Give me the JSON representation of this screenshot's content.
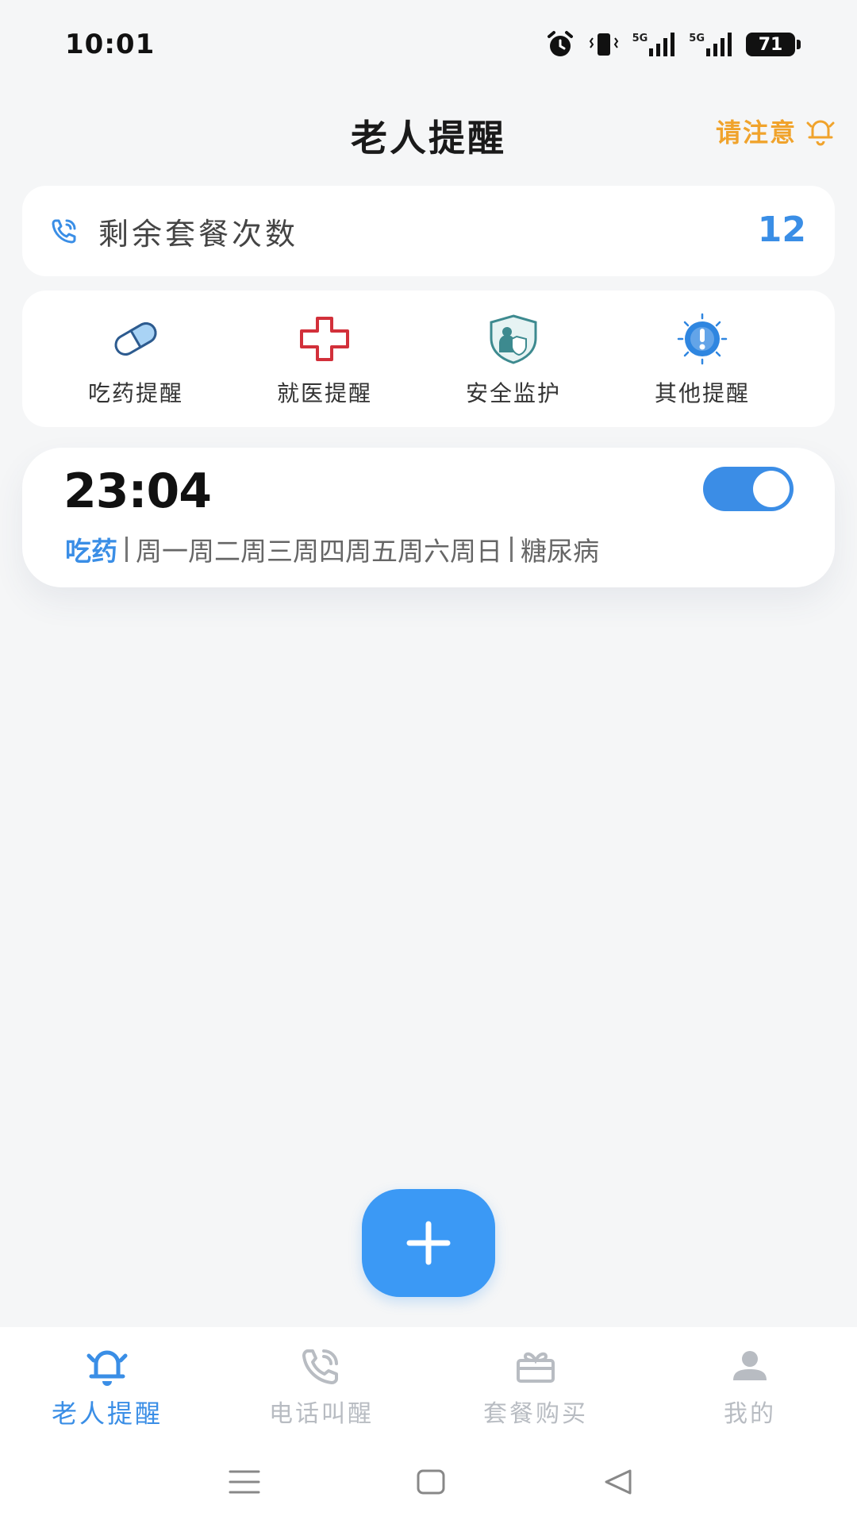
{
  "status_bar": {
    "time": "10:01",
    "signal_1_label": "5G",
    "signal_2_label": "5G",
    "battery": "71"
  },
  "header": {
    "title": "老人提醒",
    "attention_label": "请注意",
    "attention_color": "#f0a32c"
  },
  "plan": {
    "label": "剩余套餐次数",
    "count": "12",
    "icon": "phone-icon"
  },
  "categories": [
    {
      "label": "吃药提醒",
      "icon": "pill-icon"
    },
    {
      "label": "就医提醒",
      "icon": "medical-cross-icon"
    },
    {
      "label": "安全监护",
      "icon": "shield-guard-icon"
    },
    {
      "label": "其他提醒",
      "icon": "alert-icon"
    }
  ],
  "alarm": {
    "time": "23:04",
    "enabled": true,
    "type": "吃药",
    "days": "周一周二周三周四周五周六周日",
    "note": "糖尿病"
  },
  "fab": {
    "icon": "plus-icon"
  },
  "tabs": [
    {
      "label": "老人提醒",
      "icon": "bell-icon",
      "active": true
    },
    {
      "label": "电话叫醒",
      "icon": "phone-call-icon",
      "active": false
    },
    {
      "label": "套餐购买",
      "icon": "gift-box-icon",
      "active": false
    },
    {
      "label": "我的",
      "icon": "user-icon",
      "active": false
    }
  ],
  "colors": {
    "accent": "#3b8de6",
    "background": "#f5f6f7",
    "warning": "#f0a32c"
  }
}
